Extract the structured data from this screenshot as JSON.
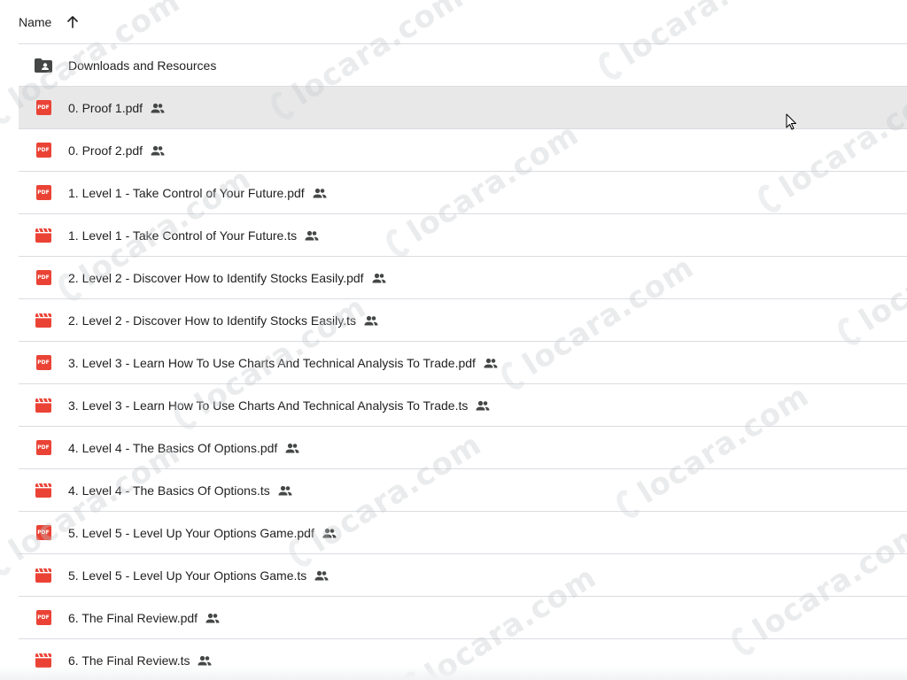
{
  "header": {
    "name_label": "Name",
    "sort_icon": "arrow-up-icon"
  },
  "colors": {
    "pdf_red": "#ea4335",
    "folder_gray": "#444746",
    "divider": "#dadce0",
    "hover_row": "#e8e8e8"
  },
  "files": [
    {
      "name": "Downloads and Resources",
      "type": "folder-shared",
      "shared": false,
      "hovered": false
    },
    {
      "name": "0. Proof 1.pdf",
      "type": "pdf",
      "shared": true,
      "hovered": true
    },
    {
      "name": "0. Proof 2.pdf",
      "type": "pdf",
      "shared": true,
      "hovered": false
    },
    {
      "name": "1. Level 1 - Take Control of Your Future.pdf",
      "type": "pdf",
      "shared": true,
      "hovered": false
    },
    {
      "name": "1. Level 1 - Take Control of Your Future.ts",
      "type": "video",
      "shared": true,
      "hovered": false
    },
    {
      "name": "2. Level 2 - Discover How to Identify Stocks Easily.pdf",
      "type": "pdf",
      "shared": true,
      "hovered": false
    },
    {
      "name": "2. Level 2 - Discover How to Identify Stocks Easily.ts",
      "type": "video",
      "shared": true,
      "hovered": false
    },
    {
      "name": "3. Level 3 - Learn How To Use Charts And Technical Analysis To Trade.pdf",
      "type": "pdf",
      "shared": true,
      "hovered": false
    },
    {
      "name": "3. Level 3 - Learn How To Use Charts And Technical Analysis To Trade.ts",
      "type": "video",
      "shared": true,
      "hovered": false
    },
    {
      "name": "4. Level 4 - The Basics Of Options.pdf",
      "type": "pdf",
      "shared": true,
      "hovered": false
    },
    {
      "name": "4. Level 4 - The Basics Of Options.ts",
      "type": "video",
      "shared": true,
      "hovered": false
    },
    {
      "name": "5. Level 5 - Level Up Your Options Game.pdf",
      "type": "pdf",
      "shared": true,
      "hovered": false
    },
    {
      "name": "5. Level 5 - Level Up Your Options Game.ts",
      "type": "video",
      "shared": true,
      "hovered": false
    },
    {
      "name": "6. The Final Review.pdf",
      "type": "pdf",
      "shared": true,
      "hovered": false
    },
    {
      "name": "6. The Final Review.ts",
      "type": "video",
      "shared": true,
      "hovered": false
    }
  ],
  "icons": {
    "pdf_badge_text": "PDF",
    "shared": "people-icon",
    "cursor": "mouse-pointer-icon"
  },
  "watermark": {
    "text": "locara.com"
  }
}
